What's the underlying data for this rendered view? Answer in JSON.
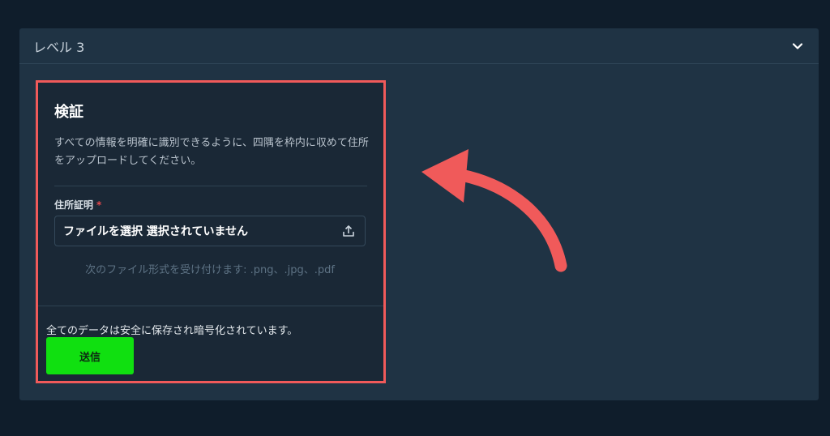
{
  "panel": {
    "title": "レベル 3",
    "toggle_icon": "chevron-down-icon"
  },
  "card": {
    "title": "検証",
    "description": "すべての情報を明確に識別できるように、四隅を枠内に収めて住所をアップロードしてください。",
    "field": {
      "label": "住所証明",
      "required_mark": "*",
      "value": "ファイルを選択 選択されていません",
      "icon": "upload-icon",
      "hint": "次のファイル形式を受け付けます: .png、.jpg、.pdf"
    },
    "security_note": "全てのデータは安全に保存され暗号化されています。",
    "submit_label": "送信"
  },
  "colors": {
    "background": "#0f1d2b",
    "panel": "#1f3344",
    "card": "#1a2836",
    "highlight_border": "#f05a5a",
    "submit_button": "#10e010",
    "annotation_arrow": "#f05a5a"
  },
  "annotation": {
    "icon": "curved-arrow-icon"
  }
}
